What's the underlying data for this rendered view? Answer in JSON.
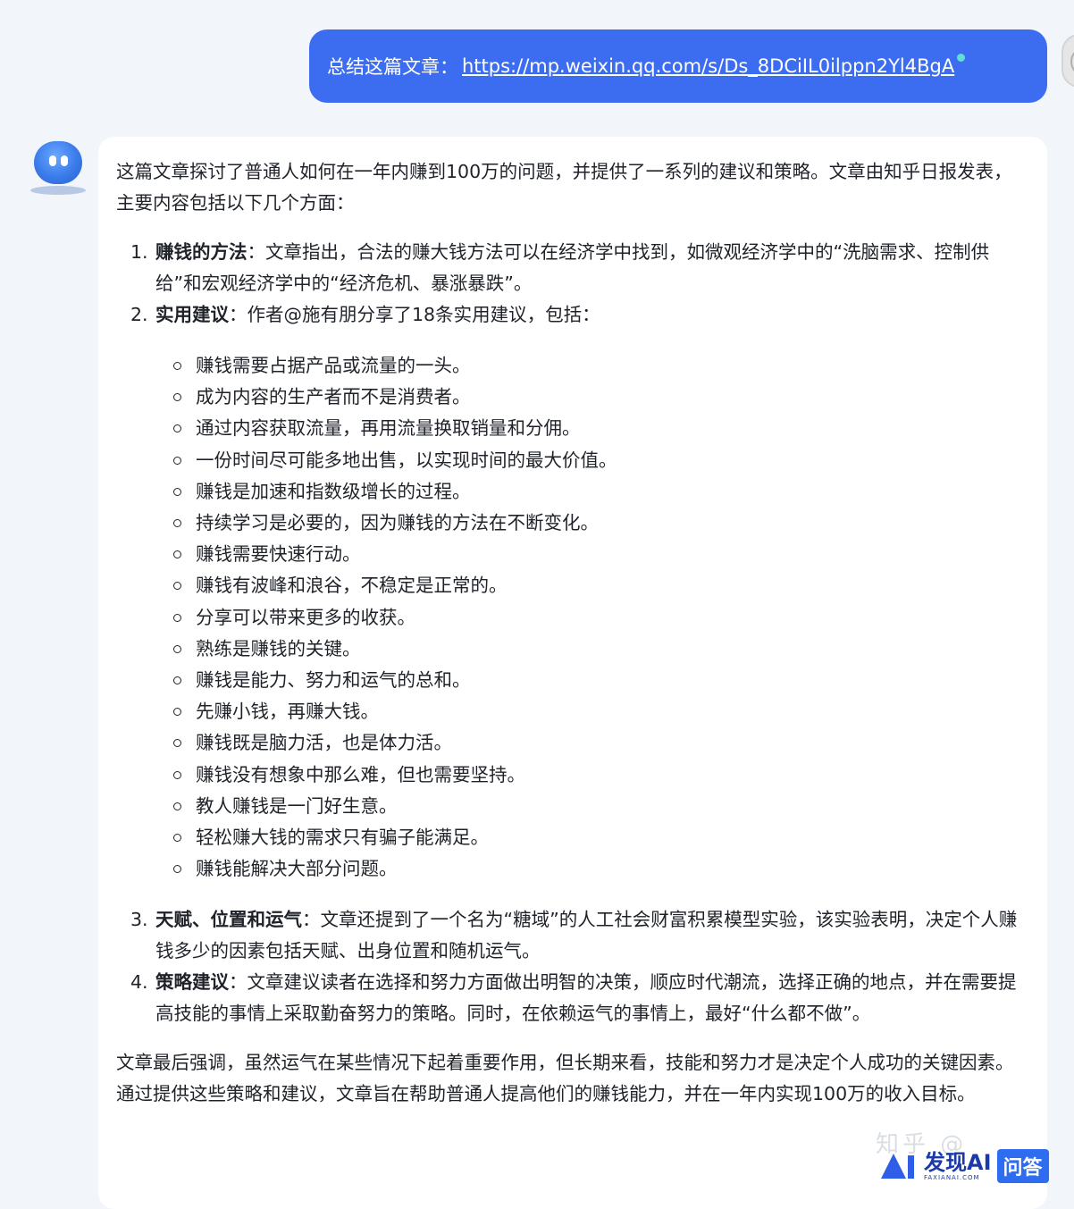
{
  "user_message": {
    "prefix": "总结这篇文章：",
    "link": "https://mp.weixin.qq.com/s/Ds_8DCiIL0ilppn2Yl4BgA"
  },
  "assistant_message": {
    "intro": "这篇文章探讨了普通人如何在一年内赚到100万的问题，并提供了一系列的建议和策略。文章由知乎日报发表，主要内容包括以下几个方面：",
    "sections": [
      {
        "number": "1.",
        "title": "赚钱的方法",
        "text": "：文章指出，合法的赚大钱方法可以在经济学中找到，如微观经济学中的“洗脑需求、控制供给”和宏观经济学中的“经济危机、暴涨暴跌”。"
      },
      {
        "number": "2.",
        "title": "实用建议",
        "text": "：作者@施有朋分享了18条实用建议，包括："
      },
      {
        "number": "3.",
        "title": "天赋、位置和运气",
        "text": "：文章还提到了一个名为“糖域”的人工社会财富积累模型实验，该实验表明，决定个人赚钱多少的因素包括天赋、出身位置和随机运气。"
      },
      {
        "number": "4.",
        "title": "策略建议",
        "text": "：文章建议读者在选择和努力方面做出明智的决策，顺应时代潮流，选择正确的地点，并在需要提高技能的事情上采取勤奋努力的策略。同时，在依赖运气的事情上，最好“什么都不做”。"
      }
    ],
    "tips": [
      "赚钱需要占据产品或流量的一头。",
      "成为内容的生产者而不是消费者。",
      "通过内容获取流量，再用流量换取销量和分佣。",
      "一份时间尽可能多地出售，以实现时间的最大价值。",
      "赚钱是加速和指数级增长的过程。",
      "持续学习是必要的，因为赚钱的方法在不断变化。",
      "赚钱需要快速行动。",
      "赚钱有波峰和浪谷，不稳定是正常的。",
      "分享可以带来更多的收获。",
      "熟练是赚钱的关键。",
      "赚钱是能力、努力和运气的总和。",
      "先赚小钱，再赚大钱。",
      "赚钱既是脑力活，也是体力活。",
      "赚钱没有想象中那么难，但也需要坚持。",
      "教人赚钱是一门好生意。",
      "轻松赚大钱的需求只有骗子能满足。",
      "赚钱能解决大部分问题。"
    ],
    "conclusion": "文章最后强调，虽然运气在某些情况下起着重要作用，但长期来看，技能和努力才是决定个人成功的关键因素。通过提供这些策略和建议，文章旨在帮助普通人提高他们的赚钱能力，并在一年内实现100万的收入目标。"
  },
  "watermark": "知乎 @",
  "brand": {
    "name": "发现AI",
    "sub": "FAXIANAI.COM",
    "badge": "问答"
  },
  "colors": {
    "user_bubble": "#3c6df0",
    "page_bg": "#f2f5fa",
    "brand_blue": "#2e5de8"
  }
}
